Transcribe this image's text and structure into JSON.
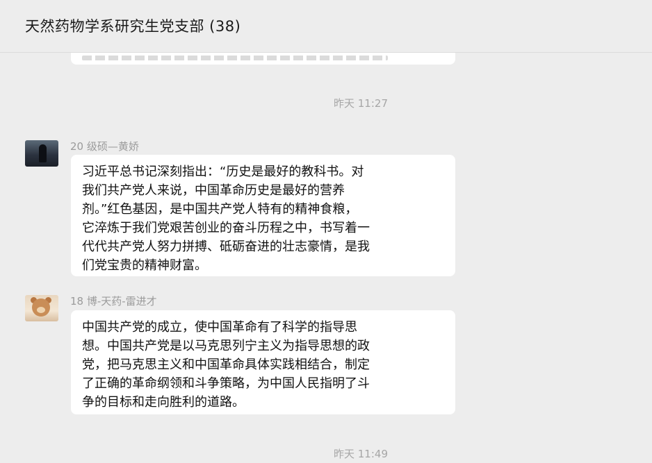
{
  "window": {
    "title": "天然药物学系研究生党支部 (38)"
  },
  "messages": {
    "timestamp_1": "昨天 11:27",
    "timestamp_2": "昨天 11:49",
    "msg1": {
      "sender": "20 级硕—黄娇",
      "avatar": "user-avatar-photo",
      "lines": [
        "习近平总书记深刻指出：“历史是最好的教科书。对",
        "我们共产党人来说，中国革命历史是最好的营养",
        "剂。”红色基因，是中国共产党人特有的精神食粮，",
        "它淬炼于我们党艰苦创业的奋斗历程之中，书写着一",
        "代代共产党人努力拼搏、砥砺奋进的壮志豪情，是我",
        "们党宝贵的精神财富。"
      ]
    },
    "msg2": {
      "sender": "18 博-天药-雷进才",
      "avatar": "teddy-bear-avatar",
      "lines": [
        "中国共产党的成立，使中国革命有了科学的指导思",
        "想。中国共产党是以马克思列宁主义为指导思想的政",
        "党，把马克思主义和中国革命具体实践相结合，制定",
        "了正确的革命纲领和斗争策略，为中国人民指明了斗",
        "争的目标和走向胜利的道路。"
      ]
    }
  }
}
